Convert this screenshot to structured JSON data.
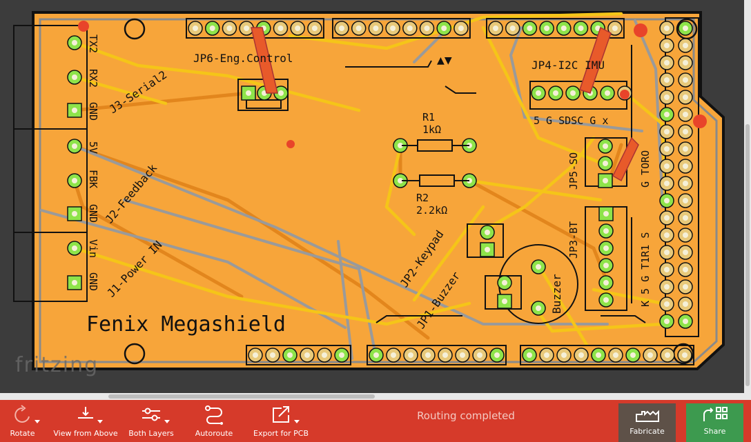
{
  "board": {
    "title": "Fenix Megashield",
    "connectors": {
      "tx2": "TX2",
      "rx2": "RX2",
      "gnd_serial": "GND",
      "serial_label": "J3-Serial2",
      "fivev": "5V",
      "fbk": "FBK",
      "gnd_fb": "GND",
      "feedback_label": "J2-Feedback",
      "vin": "Vin",
      "gnd_pwr": "GND",
      "power_label": "J1-Power IN",
      "eng_control": "JP6-Eng.Control",
      "i2c_imu": "JP4-I2C IMU",
      "i2c_pins": "5 G SDSC G x",
      "jp5": "JP5-SO",
      "toro": "G TORO",
      "jp3": "JP3-BT",
      "bt_pins": "K 5 G T1R1 S",
      "keypad": "JP2-Keypad",
      "buzzer_conn": "JP1-Buzzer",
      "buzzer": "Buzzer"
    },
    "resistors": {
      "r1_name": "R1",
      "r1_value": "1kΩ",
      "r2_name": "R2",
      "r2_value": "2.2kΩ"
    },
    "arrows": "▲▼"
  },
  "watermark": "fritzing",
  "toolbar": {
    "rotate": "Rotate",
    "view": "View from Above",
    "layers": "Both Layers",
    "autoroute": "Autoroute",
    "export": "Export for PCB",
    "status": "Routing completed",
    "fabricate": "Fabricate",
    "share": "Share"
  },
  "colors": {
    "board": "#f7a53a",
    "trace_top": "#f5c518",
    "trace_bottom": "#e88a1a",
    "pad": "#e8c97a",
    "pad_active": "#8ee34a",
    "toolbar": "#d63a2a",
    "fabricate": "#5e5148",
    "share": "#3d9a4f"
  }
}
